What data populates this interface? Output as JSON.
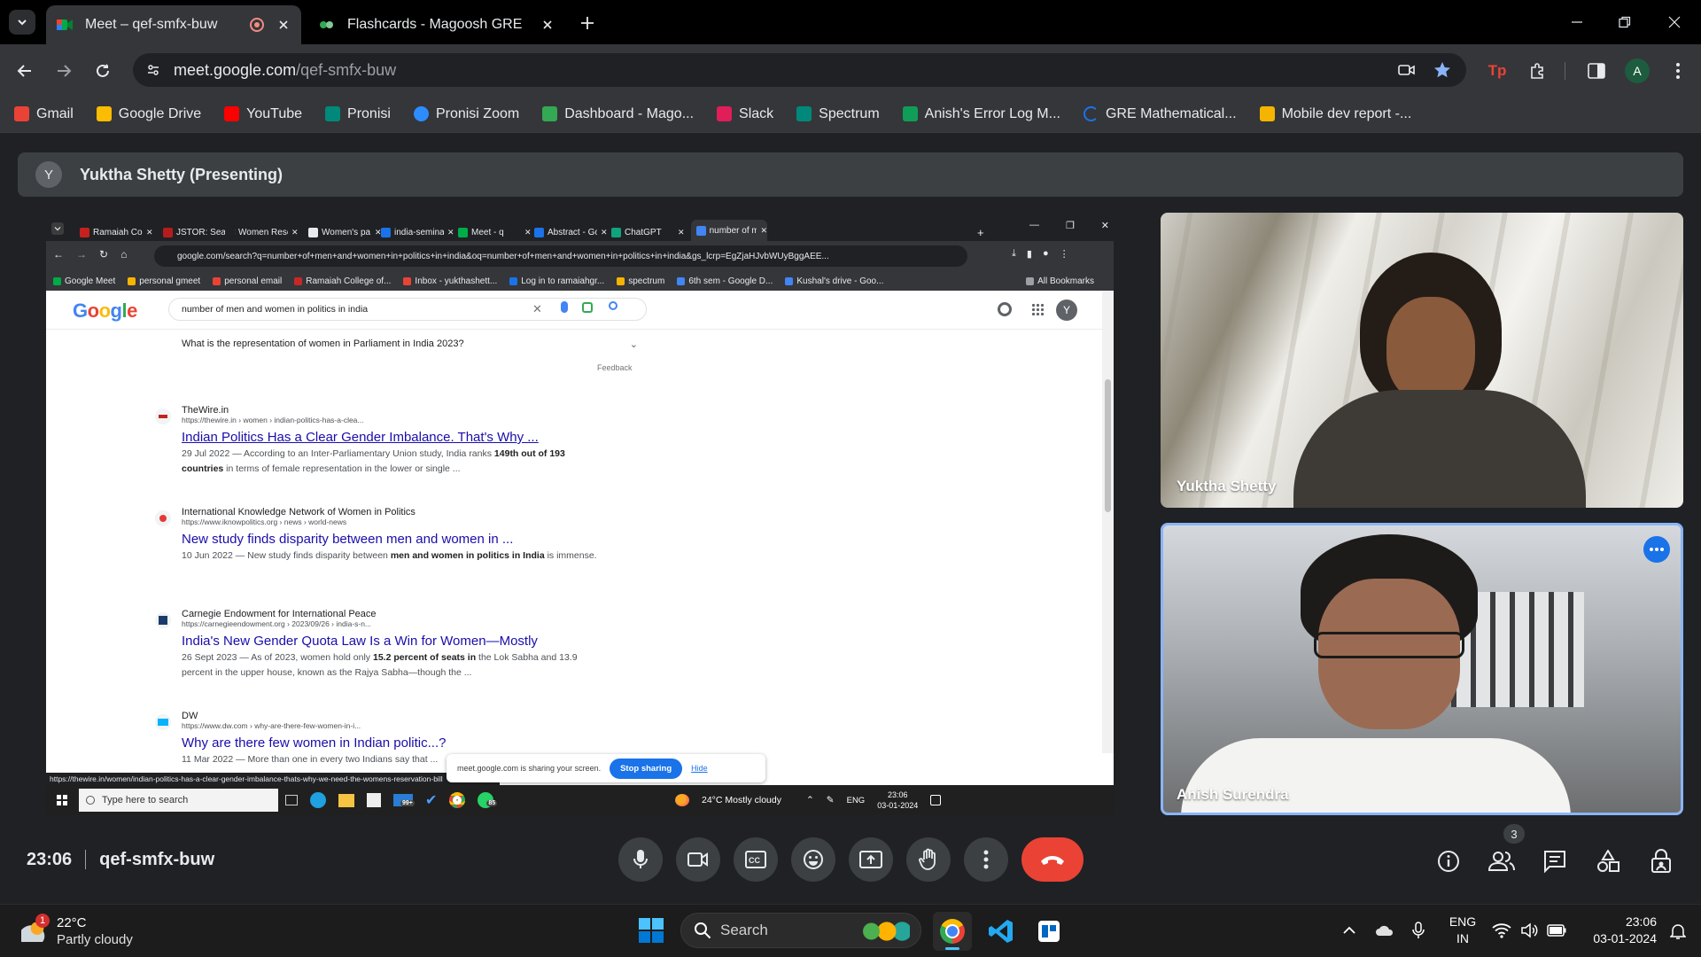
{
  "browser": {
    "tabs": [
      {
        "title": "Meet – qef-smfx-buw",
        "active": true
      },
      {
        "title": "Flashcards - Magoosh GRE",
        "active": false
      }
    ],
    "url_host": "meet.google.com",
    "url_path": "/qef-smfx-buw",
    "bookmarks": [
      {
        "label": "Gmail",
        "color": "#ea4335"
      },
      {
        "label": "Google Drive",
        "color": "#fbbc04"
      },
      {
        "label": "YouTube",
        "color": "#ff0000"
      },
      {
        "label": "Pronisi",
        "color": "#00897b"
      },
      {
        "label": "Pronisi Zoom",
        "color": "#2d8cff"
      },
      {
        "label": "Dashboard - Mago...",
        "color": "#34a853"
      },
      {
        "label": "Slack",
        "color": "#e01e5a"
      },
      {
        "label": "Spectrum",
        "color": "#00897b"
      },
      {
        "label": "Anish's Error Log M...",
        "color": "#0f9d58"
      },
      {
        "label": "GRE Mathematical...",
        "color": "#1a73e8"
      },
      {
        "label": "Mobile dev report -...",
        "color": "#f4b400"
      }
    ]
  },
  "meet": {
    "presenter_initial": "Y",
    "presenter_label": "Yuktha Shetty (Presenting)",
    "time": "23:06",
    "meeting_code": "qef-smfx-buw",
    "participant_count": "3",
    "participants": [
      {
        "name": "Yuktha Shetty"
      },
      {
        "name": "Anish Surendra"
      }
    ]
  },
  "shared_screen": {
    "tabs": [
      "Ramaiah Coll",
      "JSTOR: Searc",
      "Women Rese",
      "Women's pa",
      "india-semina",
      "Meet - q",
      "Abstract - Go",
      "ChatGPT",
      "number of m"
    ],
    "url": "google.com/search?q=number+of+men+and+women+in+politics+in+india&oq=number+of+men+and+women+in+politics+in+india&gs_lcrp=EgZjaHJvbWUyBggAEE...",
    "bookmarks": [
      "Google Meet",
      "personal gmeet",
      "personal email",
      "Ramaiah College of...",
      "Inbox - yukthashett...",
      "Log in to ramaiahgr...",
      "spectrum",
      "6th sem - Google D...",
      "Kushal's drive - Goo..."
    ],
    "all_bookmarks": "All Bookmarks",
    "google_logo": "Google",
    "search_query": "number of men and women in politics in india",
    "paa_question": "What is the representation of women in Parliament in India 2023?",
    "feedback": "Feedback",
    "results": [
      {
        "site": "TheWire.in",
        "url": "https://thewire.in › women › indian-politics-has-a-clea...",
        "title": "Indian Politics Has a Clear Gender Imbalance. That's Why ...",
        "snippet_a": "29 Jul 2022 — According to an Inter-Parliamentary Union study, India ranks ",
        "snippet_bold": "149th out of 193 countries",
        "snippet_b": " in terms of female representation in the lower or single ..."
      },
      {
        "site": "International Knowledge Network of Women in Politics",
        "url": "https://www.iknowpolitics.org › news › world-news",
        "title": "New study finds disparity between men and women in ...",
        "snippet_a": "10 Jun 2022 — New study finds disparity between ",
        "snippet_bold": "men and women in politics in India",
        "snippet_b": " is immense."
      },
      {
        "site": "Carnegie Endowment for International Peace",
        "url": "https://carnegieendowment.org › 2023/09/26 › india-s-n...",
        "title": "India's New Gender Quota Law Is a Win for Women—Mostly",
        "snippet_a": "26 Sept 2023 — As of 2023, women hold only ",
        "snippet_bold": "15.2 percent of seats in",
        "snippet_b": " the Lok Sabha and 13.9 percent in the upper house, known as the Rajya Sabha—though the ..."
      },
      {
        "site": "DW",
        "url": "https://www.dw.com › why-are-there-few-women-in-i...",
        "title": "Why are there few women in Indian politic...?",
        "snippet_a": "11 Mar 2022 — More than one in every two Indians say that ...",
        "snippet_bold": "",
        "snippet_b": ""
      }
    ],
    "status_url": "https://thewire.in/women/indian-politics-has-a-clear-gender-imbalance-thats-why-we-need-the-womens-reservation-bill",
    "sharing_text": "meet.google.com is sharing your screen.",
    "stop_sharing": "Stop sharing",
    "hide": "Hide",
    "taskbar_search": "Type here to search",
    "weather": "24°C  Mostly cloudy",
    "lang": "ENG",
    "time": "23:06",
    "date": "03-01-2024",
    "badge_mail": "99+",
    "badge_wa": "85"
  },
  "windows": {
    "weather_temp": "22°C",
    "weather_desc": "Partly cloudy",
    "weather_badge": "1",
    "search_label": "Search",
    "lang_top": "ENG",
    "lang_bottom": "IN",
    "time": "23:06",
    "date": "03-01-2024"
  }
}
